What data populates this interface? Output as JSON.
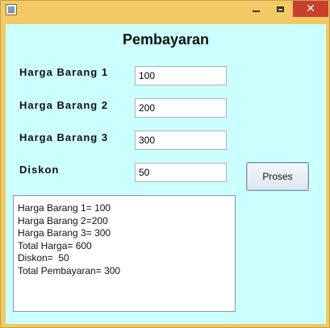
{
  "window": {
    "controls": {
      "minimize_icon": "minimize-icon",
      "maximize_icon": "maximize-icon",
      "close_glyph": "✕"
    }
  },
  "form": {
    "title": "Pembayaran",
    "fields": [
      {
        "label": "Harga Barang 1",
        "value": "100"
      },
      {
        "label": "Harga Barang 2",
        "value": "200"
      },
      {
        "label": "Harga Barang 3",
        "value": "300"
      },
      {
        "label": "Diskon",
        "value": "50"
      }
    ],
    "button_label": "Proses"
  },
  "output": {
    "lines": [
      "Harga Barang 1= 100",
      "Harga Barang 2=200",
      "Harga Barang 3= 300",
      "Total Harga= 600",
      "Diskon=  50",
      "Total Pembayaran= 300"
    ]
  },
  "colors": {
    "title_bar": "#f2c965",
    "client_background": "#ccffff",
    "close_button": "#c7402f"
  }
}
